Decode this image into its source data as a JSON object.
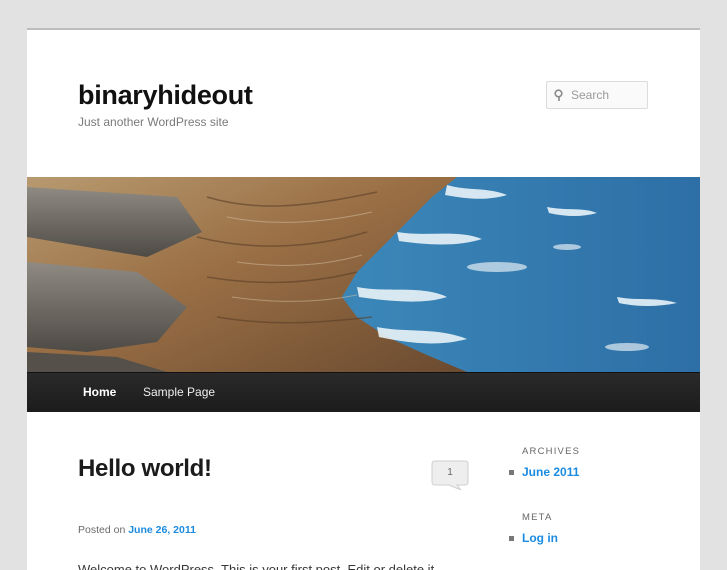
{
  "site": {
    "title": "binaryhideout",
    "tagline": "Just another WordPress site"
  },
  "search": {
    "placeholder": "Search"
  },
  "nav": {
    "items": [
      {
        "label": "Home",
        "active": true
      },
      {
        "label": "Sample Page",
        "active": false
      }
    ]
  },
  "post": {
    "title": "Hello world!",
    "comment_count": "1",
    "posted_on_label": "Posted on",
    "date": "June 26, 2011",
    "excerpt": "Welcome to WordPress. This is your first post. Edit or delete it,"
  },
  "sidebar": {
    "archives": {
      "title": "ARCHIVES",
      "items": [
        "June 2011"
      ]
    },
    "meta": {
      "title": "META",
      "items": [
        "Log in"
      ]
    }
  },
  "colors": {
    "link": "#1b8be0",
    "nav_bg": "#222222",
    "page_bg": "#ffffff",
    "body_bg": "#e2e2e2"
  }
}
